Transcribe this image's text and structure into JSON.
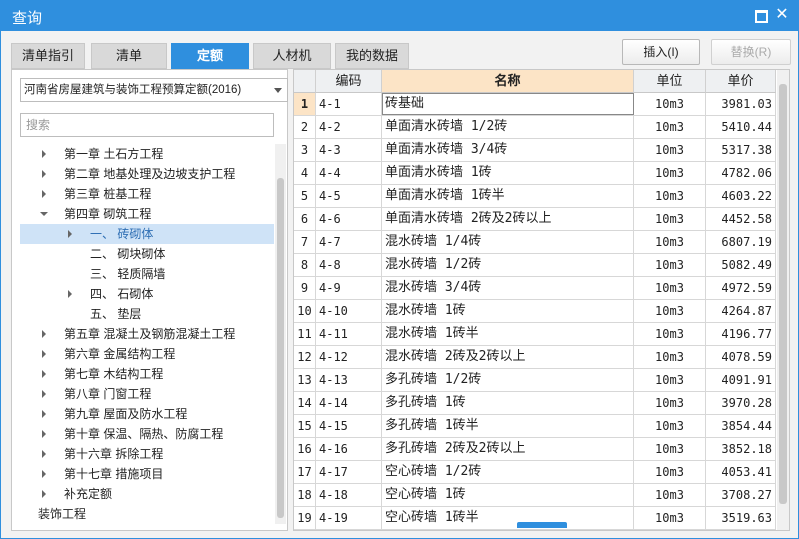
{
  "window": {
    "title": "查询",
    "maximize_icon": "maximize-icon",
    "close_icon": "close-icon"
  },
  "tabs": [
    {
      "label": "清单指引",
      "active": false
    },
    {
      "label": "清单",
      "active": false
    },
    {
      "label": "定额",
      "active": true
    },
    {
      "label": "人材机",
      "active": false
    },
    {
      "label": "我的数据",
      "active": false
    }
  ],
  "actions": {
    "insert_label": "插入(I)",
    "replace_label": "替换(R)"
  },
  "left": {
    "quota_library": "河南省房屋建筑与装饰工程预算定额(2016)",
    "search_placeholder": "搜索",
    "tree": [
      {
        "label": "第一章  土石方工程",
        "expander": "right"
      },
      {
        "label": "第二章  地基处理及边坡支护工程",
        "expander": "right"
      },
      {
        "label": "第三章  桩基工程",
        "expander": "right"
      },
      {
        "label": "第四章  砌筑工程",
        "expander": "down"
      },
      {
        "label": "一、  砖砌体",
        "expander": "right",
        "selected": true
      },
      {
        "label": "二、  砌块砌体",
        "expander": ""
      },
      {
        "label": "三、  轻质隔墙",
        "expander": ""
      },
      {
        "label": "四、  石砌体",
        "expander": "right"
      },
      {
        "label": "五、  垫层",
        "expander": ""
      },
      {
        "label": "第五章  混凝土及钢筋混凝土工程",
        "expander": "right"
      },
      {
        "label": "第六章  金属结构工程",
        "expander": "right"
      },
      {
        "label": "第七章  木结构工程",
        "expander": "right"
      },
      {
        "label": "第八章  门窗工程",
        "expander": "right"
      },
      {
        "label": "第九章  屋面及防水工程",
        "expander": "right"
      },
      {
        "label": "第十章  保温、隔热、防腐工程",
        "expander": "right"
      },
      {
        "label": "第十六章  拆除工程",
        "expander": "right"
      },
      {
        "label": "第十七章  措施项目",
        "expander": "right"
      },
      {
        "label": "补充定额",
        "expander": "right"
      },
      {
        "label": "装饰工程",
        "expander": "right"
      }
    ]
  },
  "table": {
    "columns": [
      "编码",
      "名称",
      "单位",
      "单价"
    ],
    "rows": [
      {
        "idx": "1",
        "code": "4-1",
        "name": "砖基础",
        "unit": "10m3",
        "price": "3981.03"
      },
      {
        "idx": "2",
        "code": "4-2",
        "name": "单面清水砖墙 1/2砖",
        "unit": "10m3",
        "price": "5410.44"
      },
      {
        "idx": "3",
        "code": "4-3",
        "name": "单面清水砖墙 3/4砖",
        "unit": "10m3",
        "price": "5317.38"
      },
      {
        "idx": "4",
        "code": "4-4",
        "name": "单面清水砖墙 1砖",
        "unit": "10m3",
        "price": "4782.06"
      },
      {
        "idx": "5",
        "code": "4-5",
        "name": "单面清水砖墙 1砖半",
        "unit": "10m3",
        "price": "4603.22"
      },
      {
        "idx": "6",
        "code": "4-6",
        "name": "单面清水砖墙 2砖及2砖以上",
        "unit": "10m3",
        "price": "4452.58"
      },
      {
        "idx": "7",
        "code": "4-7",
        "name": "混水砖墙 1/4砖",
        "unit": "10m3",
        "price": "6807.19"
      },
      {
        "idx": "8",
        "code": "4-8",
        "name": "混水砖墙 1/2砖",
        "unit": "10m3",
        "price": "5082.49"
      },
      {
        "idx": "9",
        "code": "4-9",
        "name": "混水砖墙 3/4砖",
        "unit": "10m3",
        "price": "4972.59"
      },
      {
        "idx": "10",
        "code": "4-10",
        "name": "混水砖墙 1砖",
        "unit": "10m3",
        "price": "4264.87"
      },
      {
        "idx": "11",
        "code": "4-11",
        "name": "混水砖墙 1砖半",
        "unit": "10m3",
        "price": "4196.77"
      },
      {
        "idx": "12",
        "code": "4-12",
        "name": "混水砖墙 2砖及2砖以上",
        "unit": "10m3",
        "price": "4078.59"
      },
      {
        "idx": "13",
        "code": "4-13",
        "name": "多孔砖墙 1/2砖",
        "unit": "10m3",
        "price": "4091.91"
      },
      {
        "idx": "14",
        "code": "4-14",
        "name": "多孔砖墙 1砖",
        "unit": "10m3",
        "price": "3970.28"
      },
      {
        "idx": "15",
        "code": "4-15",
        "name": "多孔砖墙 1砖半",
        "unit": "10m3",
        "price": "3854.44"
      },
      {
        "idx": "16",
        "code": "4-16",
        "name": "多孔砖墙 2砖及2砖以上",
        "unit": "10m3",
        "price": "3852.18"
      },
      {
        "idx": "17",
        "code": "4-17",
        "name": "空心砖墙 1/2砖",
        "unit": "10m3",
        "price": "4053.41"
      },
      {
        "idx": "18",
        "code": "4-18",
        "name": "空心砖墙 1砖",
        "unit": "10m3",
        "price": "3708.27"
      },
      {
        "idx": "19",
        "code": "4-19",
        "name": "空心砖墙 1砖半",
        "unit": "10m3",
        "price": "3519.63"
      }
    ]
  },
  "colors": {
    "accent": "#2f8fde",
    "header_highlight": "#fce4c6",
    "tree_selected": "#cfe3f7"
  }
}
